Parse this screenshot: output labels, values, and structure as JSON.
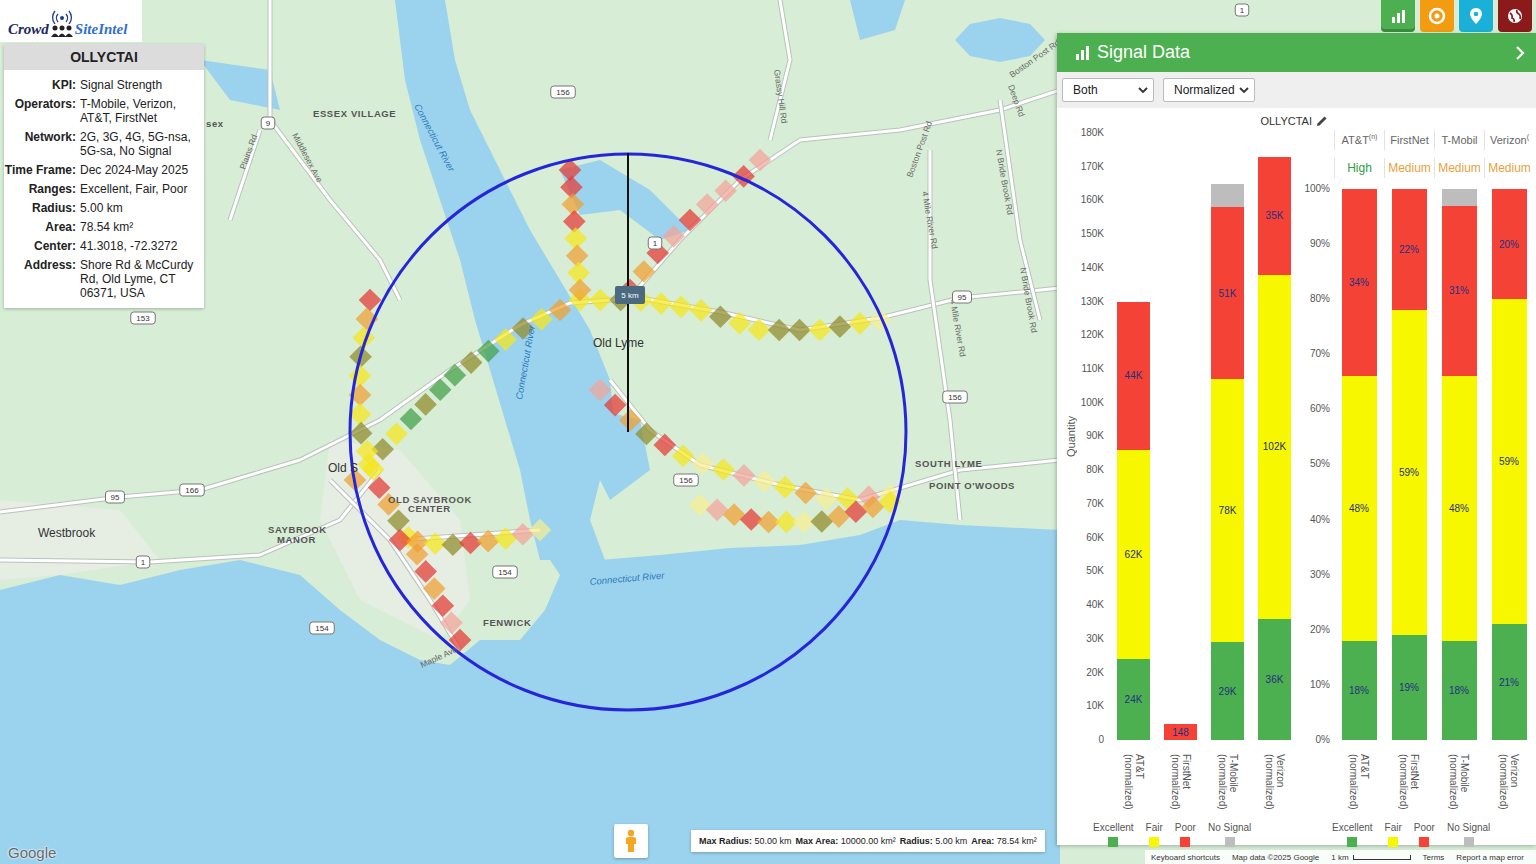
{
  "brand": {
    "prefix": "Crowd",
    "suffix": "SiteIntel"
  },
  "info_card": {
    "title": "OLLYCTAI",
    "rows": [
      {
        "label": "KPI:",
        "value": "Signal Strength"
      },
      {
        "label": "Operators:",
        "value": "T-Mobile, Verizon, AT&T, FirstNet"
      },
      {
        "label": "Network:",
        "value": "2G, 3G, 4G, 5G-nsa, 5G-sa, No Signal"
      },
      {
        "label": "Time Frame:",
        "value": "Dec 2024-May 2025"
      },
      {
        "label": "Ranges:",
        "value": "Excellent, Fair, Poor"
      },
      {
        "label": "Radius:",
        "value": "5.00 km"
      },
      {
        "label": "Area:",
        "value": "78.54 km²"
      },
      {
        "label": "Center:",
        "value": "41.3018, -72.3272"
      },
      {
        "label": "Address:",
        "value": "Shore Rd & McCurdy Rd, Old Lyme, CT 06371, USA"
      }
    ]
  },
  "toolbar": {
    "buttons": [
      {
        "color": "#4caf50",
        "selected": true
      },
      {
        "color": "#f39c12",
        "selected": false
      },
      {
        "color": "#1ab0d8",
        "selected": false
      },
      {
        "color": "#8b1a1a",
        "selected": false
      }
    ]
  },
  "map": {
    "labels": [
      {
        "text": "ESSEX VILLAGE",
        "kind": "town"
      },
      {
        "text": "sex",
        "kind": "town"
      },
      {
        "text": "Connecticut River",
        "kind": "water"
      },
      {
        "text": "Old Lyme",
        "kind": "place"
      },
      {
        "text": "Old S",
        "kind": "place"
      },
      {
        "text": "Westbrook",
        "kind": "place"
      },
      {
        "text": "SAYBROOK",
        "kind": "town"
      },
      {
        "text": "MANOR",
        "kind": "town"
      },
      {
        "text": "OLD SAYBROOK",
        "kind": "town"
      },
      {
        "text": "CENTER",
        "kind": "town"
      },
      {
        "text": "FENWICK",
        "kind": "town"
      },
      {
        "text": "Connecticut River",
        "kind": "water"
      },
      {
        "text": "Connecticut River",
        "kind": "water"
      },
      {
        "text": "SOUTH LYME",
        "kind": "town"
      },
      {
        "text": "POINT O'WOODS",
        "kind": "town"
      },
      {
        "text": "Grassy Hill Rd",
        "kind": "road"
      },
      {
        "text": "Boston Post Rd",
        "kind": "road"
      },
      {
        "text": "Deep Rd",
        "kind": "road"
      },
      {
        "text": "Boston Post Rd",
        "kind": "road"
      },
      {
        "text": "4 Mile River Rd",
        "kind": "road"
      },
      {
        "text": "N Bride Brook Rd",
        "kind": "road"
      },
      {
        "text": "4 Mile River Rd",
        "kind": "road"
      },
      {
        "text": "N Bride Brook Rd",
        "kind": "road"
      },
      {
        "text": "Plains Rd",
        "kind": "road"
      },
      {
        "text": "Middlesex Ave",
        "kind": "road"
      },
      {
        "text": "Maple Ave",
        "kind": "road"
      }
    ],
    "shields": [
      {
        "text": "156"
      },
      {
        "text": "156"
      },
      {
        "text": "156"
      },
      {
        "text": "154"
      },
      {
        "text": "154"
      },
      {
        "text": "166"
      },
      {
        "text": "153"
      },
      {
        "text": "1"
      },
      {
        "text": "1"
      },
      {
        "text": "9"
      },
      {
        "text": "95"
      },
      {
        "text": "95"
      },
      {
        "text": "1"
      }
    ],
    "radius_label": "5 km",
    "heatmap": {
      "tracks": [
        {
          "cells": [
            "#f0a030",
            "#f5e61b",
            "#8f8a2a",
            "#f5e61b",
            "#43a047",
            "#8f8a2a",
            "#43a047",
            "#43a047",
            "#8f8a2a",
            "#43a047",
            "#f5e61b",
            "#8f8a2a",
            "#f5e61b",
            "#f0a030"
          ]
        },
        {
          "cells": [
            "#f5e61b",
            "#f5e61b",
            "#8f8a2a",
            "#f5e61b",
            "#f5e61b",
            "#f5e61b",
            "#f5e61b",
            "#8f8a2a",
            "#f5e61b",
            "#f5e61b",
            "#8f8a2a",
            "#8f8a2a",
            "#f5e61b",
            "#8f8a2a",
            "#f5e61b",
            "#f6ef93"
          ]
        },
        {
          "cells": [
            "#e53935",
            "#f0a030",
            "#e53935",
            "#f3a39a",
            "#e53935",
            "#f3a39a",
            "#f3a39a",
            "#e53935",
            "#f3a39a"
          ]
        },
        {
          "cells": [
            "#e53935",
            "#e53935",
            "#f0a030",
            "#e53935",
            "#f5e61b",
            "#f0a030",
            "#f5e61b",
            "#f0a030"
          ]
        },
        {
          "cells": [
            "#f3a39a",
            "#e53935",
            "#f0a030",
            "#8f8a2a",
            "#e53935",
            "#f5e61b",
            "#f6ef93",
            "#f5e61b",
            "#f3a39a",
            "#f6ef93",
            "#f5e61b",
            "#f0a030",
            "#f6ef93",
            "#f5e61b",
            "#f3a39a",
            "#f6ef93"
          ]
        },
        {
          "cells": [
            "#e53935",
            "#f0a030",
            "#f5e61b",
            "#8f8a2a",
            "#f5e61b",
            "#f0a030",
            "#f5e61b",
            "#8f8a2a",
            "#f5e61b",
            "#f5e61b",
            "#e53935",
            "#f0a030",
            "#8f8a2a",
            "#f5e61b",
            "#f0a030",
            "#e53935",
            "#f0a030",
            "#e53935",
            "#f3a39a",
            "#e53935"
          ]
        },
        {
          "cells": [
            "#e53935",
            "#f0a030",
            "#f5e61b",
            "#8f8a2a",
            "#e53935",
            "#f0a030",
            "#f5e61b",
            "#f3a39a",
            "#f6ef93"
          ]
        },
        {
          "cells": [
            "#f6ef93",
            "#f3a39a",
            "#f0a030",
            "#e53935",
            "#f0a030",
            "#f5e61b",
            "#f6ef93",
            "#8f8a2a",
            "#f0a030",
            "#e53935",
            "#f0a030",
            "#f5e61b"
          ]
        }
      ]
    }
  },
  "panel": {
    "title": "Signal Data",
    "selects": [
      {
        "value": "Both"
      },
      {
        "value": "Normalized"
      }
    ]
  },
  "series": [
    {
      "name": "Excellent",
      "color": "#4caf50"
    },
    {
      "name": "Fair",
      "color": "#f7f700"
    },
    {
      "name": "Poor",
      "color": "#f44336"
    },
    {
      "name": "No Signal",
      "color": "#bdbdbd"
    }
  ],
  "chart_abs": {
    "title": "OLLYCTAI",
    "y_axis_title": "Quantity",
    "max": 180000,
    "ticks": [
      "0",
      "10K",
      "20K",
      "30K",
      "40K",
      "50K",
      "60K",
      "70K",
      "80K",
      "90K",
      "100K",
      "110K",
      "120K",
      "130K",
      "140K",
      "150K",
      "160K",
      "170K",
      "180K"
    ],
    "categories": [
      {
        "lines": [
          "AT&T",
          "(normalized)"
        ]
      },
      {
        "lines": [
          "FirstNet",
          "(normalized)"
        ]
      },
      {
        "lines": [
          "T-Mobile",
          "(normalized)"
        ]
      },
      {
        "lines": [
          "Verizon",
          "(normalized)"
        ]
      }
    ],
    "values": [
      [
        24000,
        0,
        29000,
        36000
      ],
      [
        62000,
        0,
        78000,
        102000
      ],
      [
        44000,
        148,
        51000,
        35000
      ],
      [
        0,
        0,
        7000,
        0
      ]
    ],
    "labels": [
      [
        "24K",
        "",
        "29K",
        "36K"
      ],
      [
        "62K",
        "",
        "78K",
        "102K"
      ],
      [
        "44K",
        "148",
        "51K",
        "35K"
      ],
      [
        "",
        "",
        "",
        ""
      ]
    ]
  },
  "chart_pct": {
    "max": 100,
    "ticks": [
      "0%",
      "10%",
      "20%",
      "30%",
      "40%",
      "50%",
      "60%",
      "70%",
      "80%",
      "90%",
      "100%"
    ],
    "columns": [
      {
        "name": "AT&T",
        "sup": "(n)",
        "level": "High",
        "color": "#2e9e3e"
      },
      {
        "name": "FirstNet",
        "sup": "",
        "level": "Medium",
        "color": "#e6a23c"
      },
      {
        "name": "T-Mobil",
        "sup": "",
        "level": "Medium",
        "color": "#e6a23c"
      },
      {
        "name": "Verizon",
        "sup": "(",
        "level": "Medium",
        "color": "#e6a23c"
      }
    ],
    "categories": [
      {
        "lines": [
          "AT&T",
          "(normalized)"
        ]
      },
      {
        "lines": [
          "FirstNet",
          "(normalized)"
        ]
      },
      {
        "lines": [
          "T-Mobile",
          "(normalized)"
        ]
      },
      {
        "lines": [
          "Verizon",
          "(normalized)"
        ]
      }
    ],
    "values": [
      [
        18,
        19,
        18,
        21
      ],
      [
        48,
        59,
        48,
        59
      ],
      [
        34,
        22,
        31,
        20
      ],
      [
        0,
        0,
        3,
        0
      ]
    ],
    "labels": [
      [
        "18%",
        "19%",
        "18%",
        "21%"
      ],
      [
        "48%",
        "59%",
        "48%",
        "59%"
      ],
      [
        "34%",
        "22%",
        "31%",
        "20%"
      ],
      [
        "",
        "",
        "",
        ""
      ]
    ]
  },
  "status": {
    "items": [
      {
        "label": "Max Radius:",
        "value": "50.00 km"
      },
      {
        "label": "Max Area:",
        "value": "10000.00 km²"
      },
      {
        "label": "Radius:",
        "value": "5.00 km"
      },
      {
        "label": "Area:",
        "value": "78.54 km²"
      }
    ]
  },
  "footer": {
    "google": "Google",
    "links": [
      "Keyboard shortcuts",
      "Map data ©2025 Google",
      "1 km",
      "Terms",
      "Report a map error"
    ]
  }
}
